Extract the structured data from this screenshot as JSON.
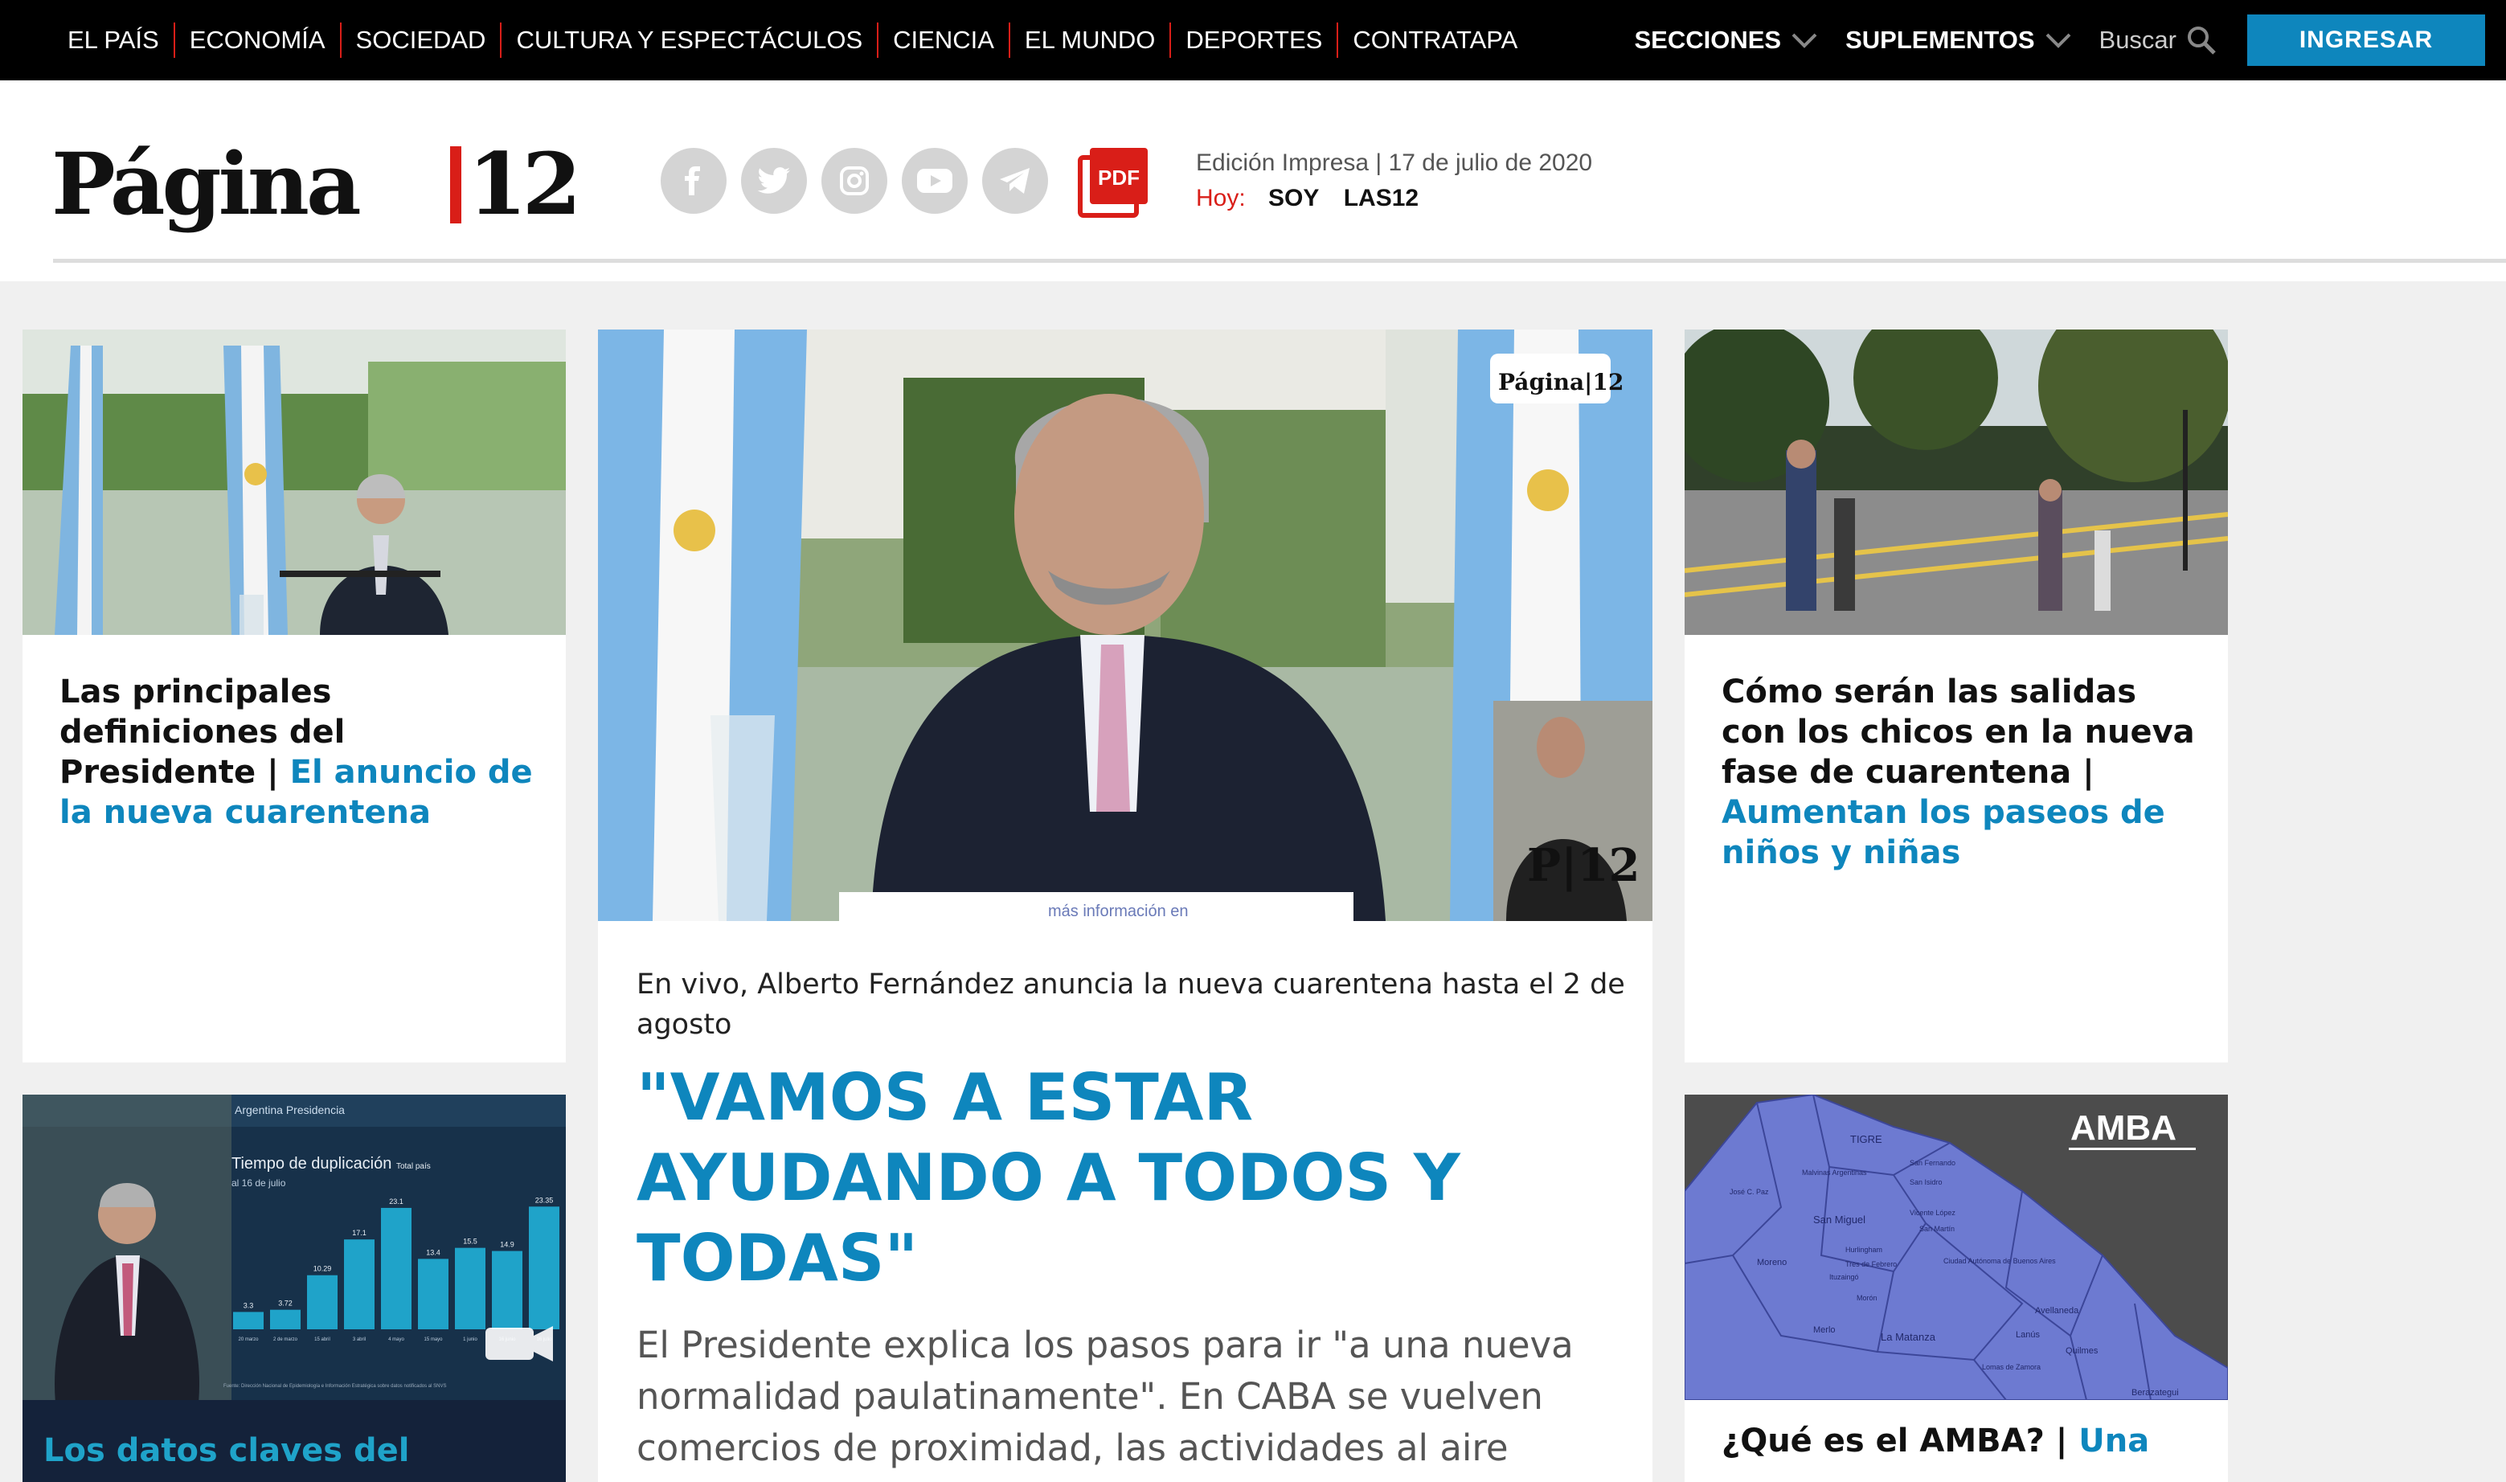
{
  "nav": {
    "links": [
      "EL PAÍS",
      "ECONOMÍA",
      "SOCIEDAD",
      "CULTURA Y ESPECTÁCULOS",
      "CIENCIA",
      "EL MUNDO",
      "DEPORTES",
      "CONTRATAPA"
    ],
    "secciones": "SECCIONES",
    "suplementos": "SUPLEMENTOS",
    "search_placeholder": "Buscar",
    "login": "INGRESAR"
  },
  "header": {
    "logo_text": "Página|12",
    "social_icons": [
      "facebook-icon",
      "twitter-icon",
      "instagram-icon",
      "youtube-icon",
      "telegram-icon"
    ],
    "pdf_label": "PDF",
    "edition": "Edición Impresa | 17 de julio de 2020",
    "hoy_label": "Hoy:",
    "hoy_links": [
      "SOY",
      "LAS12"
    ]
  },
  "articles": {
    "left_top": {
      "title": "Las principales definiciones del Presidente |",
      "subtitle": "El anuncio de la nueva cuarentena"
    },
    "main": {
      "image_logo": "Página|12",
      "image_bug": "P|12",
      "image_caption": "más información en",
      "kicker": "En vivo, Alberto Fernández anuncia la nueva cuarentena hasta el 2 de agosto",
      "title": "\"VAMOS A ESTAR AYUDANDO A TODOS Y TODAS\"",
      "summary": "El Presidente explica los pasos para ir \"a una nueva normalidad paulatinamente\". En CABA se vuelven comercios de proximidad, las actividades al aire"
    },
    "right_top": {
      "title": "Cómo serán las salidas con los chicos en la nueva fase de cuarentena |",
      "subtitle": "Aumentan los paseos de niños y niñas"
    },
    "left_bottom": {
      "title": "Los datos claves del",
      "chart_header": "Argentina Presidencia",
      "chart_title": "Tiempo de duplicación",
      "chart_title_small": "Total país",
      "chart_subtitle": "al 16 de julio",
      "chart_source": "Fuente: Dirección Nacional de Epidemiología e Información Estratégica sobre datos notificados al SNVS"
    },
    "right_bottom": {
      "title": "¿Qué es el AMBA? |",
      "subtitle": "Una",
      "map_label": "AMBA",
      "map_places": [
        "TIGRE",
        "Malvinas Argentinas",
        "José C. Paz",
        "San Isidro",
        "San Fernando",
        "San Miguel",
        "Vicente López",
        "Hurlingham",
        "San Martín",
        "Ciudad Autónoma de Buenos Aires",
        "Moreno",
        "Ituzaingó",
        "Morón",
        "Tres de Febrero",
        "Merlo",
        "La Matanza",
        "Avellaneda",
        "Lanús",
        "Quilmes",
        "Lomas de Zamora",
        "Berazategui"
      ]
    }
  },
  "chart_data": {
    "type": "bar",
    "title": "Tiempo de duplicación",
    "categories": [
      "20 marzo",
      "2 de marzo",
      "15 abril",
      "3 abril",
      "4 mayo",
      "15 mayo",
      "1 junio",
      "16 junio",
      "16 julio"
    ],
    "values": [
      3.3,
      3.72,
      10.29,
      17.1,
      23.1,
      13.4,
      15.5,
      14.9,
      23.35
    ],
    "ylim": [
      0,
      26
    ],
    "colors": {
      "bar": "#1fa3c9"
    }
  },
  "colors": {
    "accent": "#0e86bd",
    "brand_red": "#d91e18"
  }
}
